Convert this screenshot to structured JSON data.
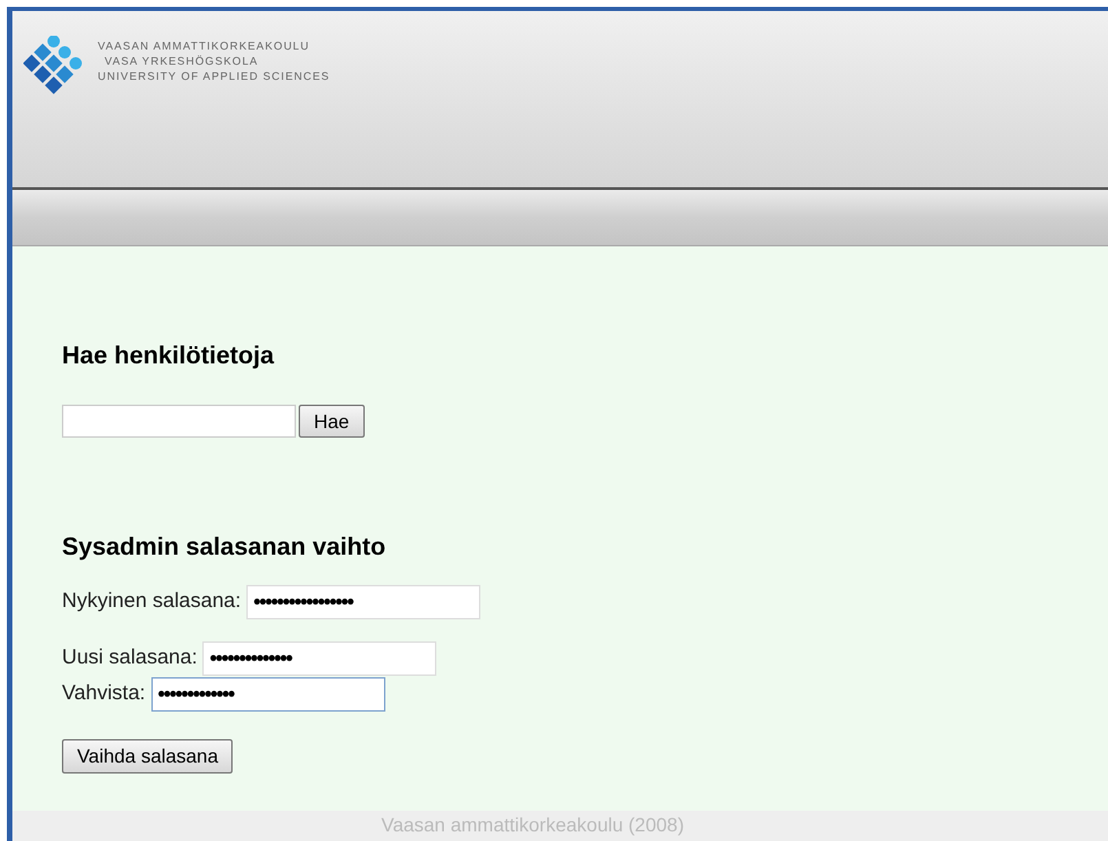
{
  "header": {
    "logo_lines": [
      "VAASAN AMMATTIKORKEAKOULU",
      "VASA YRKESHÖGSKOLA",
      "UNIVERSITY OF APPLIED SCIENCES"
    ]
  },
  "search_section": {
    "title": "Hae henkilötietoja",
    "button": "Hae"
  },
  "password_section": {
    "title": "Sysadmin salasanan vaihto",
    "field_groups": [
      [
        {
          "label": "Nykyinen salasana:",
          "value": "•••••••••••••••••",
          "focused": false
        }
      ],
      [
        {
          "label": "Uusi salasana:",
          "value": "••••••••••••••",
          "focused": false
        },
        {
          "label": "Vahvista:",
          "value": "•••••••••••••",
          "focused": true
        }
      ]
    ],
    "button": "Vaihda salasana"
  },
  "footer": "Vaasan ammattikorkeakoulu (2008)"
}
